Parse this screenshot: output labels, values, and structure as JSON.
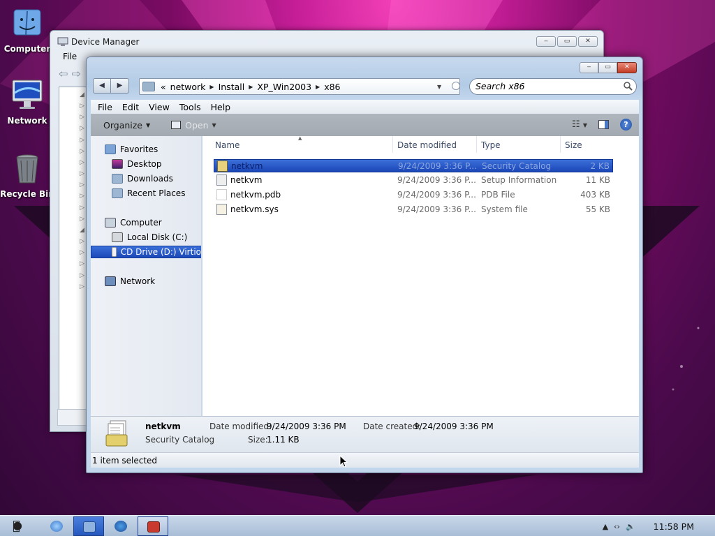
{
  "desktop": {
    "icons": [
      {
        "label": "Computer"
      },
      {
        "label": "Network"
      },
      {
        "label": "Recycle Bin"
      }
    ]
  },
  "device_manager": {
    "title": "Device Manager",
    "menu_first": "File"
  },
  "explorer": {
    "breadcrumb": [
      "«",
      "network",
      "Install",
      "XP_Win2003",
      "x86"
    ],
    "search_placeholder": "Search x86",
    "menu": [
      "File",
      "Edit",
      "View",
      "Tools",
      "Help"
    ],
    "toolbar": {
      "organize": "Organize",
      "open": "Open"
    },
    "nav": {
      "favorites": "Favorites",
      "desktop": "Desktop",
      "downloads": "Downloads",
      "recent": "Recent Places",
      "computer": "Computer",
      "local_disk": "Local Disk (C:)",
      "cd_drive": "CD Drive (D:) Virtio",
      "network": "Network"
    },
    "columns": {
      "name": "Name",
      "date": "Date modified",
      "type": "Type",
      "size": "Size"
    },
    "files": [
      {
        "name": "netkvm",
        "date": "9/24/2009 3:36 P...",
        "type": "Security Catalog",
        "size": "2 KB",
        "selected": true
      },
      {
        "name": "netkvm",
        "date": "9/24/2009 3:36 P...",
        "type": "Setup Information",
        "size": "11 KB",
        "selected": false
      },
      {
        "name": "netkvm.pdb",
        "date": "9/24/2009 3:36 P...",
        "type": "PDB File",
        "size": "403 KB",
        "selected": false
      },
      {
        "name": "netkvm.sys",
        "date": "9/24/2009 3:36 P...",
        "type": "System file",
        "size": "55 KB",
        "selected": false
      }
    ],
    "details": {
      "name": "netkvm",
      "type": "Security Catalog",
      "date_modified_label": "Date modified:",
      "date_modified": "9/24/2009 3:36 PM",
      "date_created_label": "Date created:",
      "date_created": "9/24/2009 3:36 PM",
      "size_label": "Size:",
      "size": "1.11 KB"
    },
    "status": "1 item selected"
  },
  "taskbar": {
    "clock": "11:58 PM"
  },
  "colors": {
    "selection": "#2a5cc9",
    "desktop": "#7a0b63",
    "toolbar": "#a9b0b8"
  }
}
